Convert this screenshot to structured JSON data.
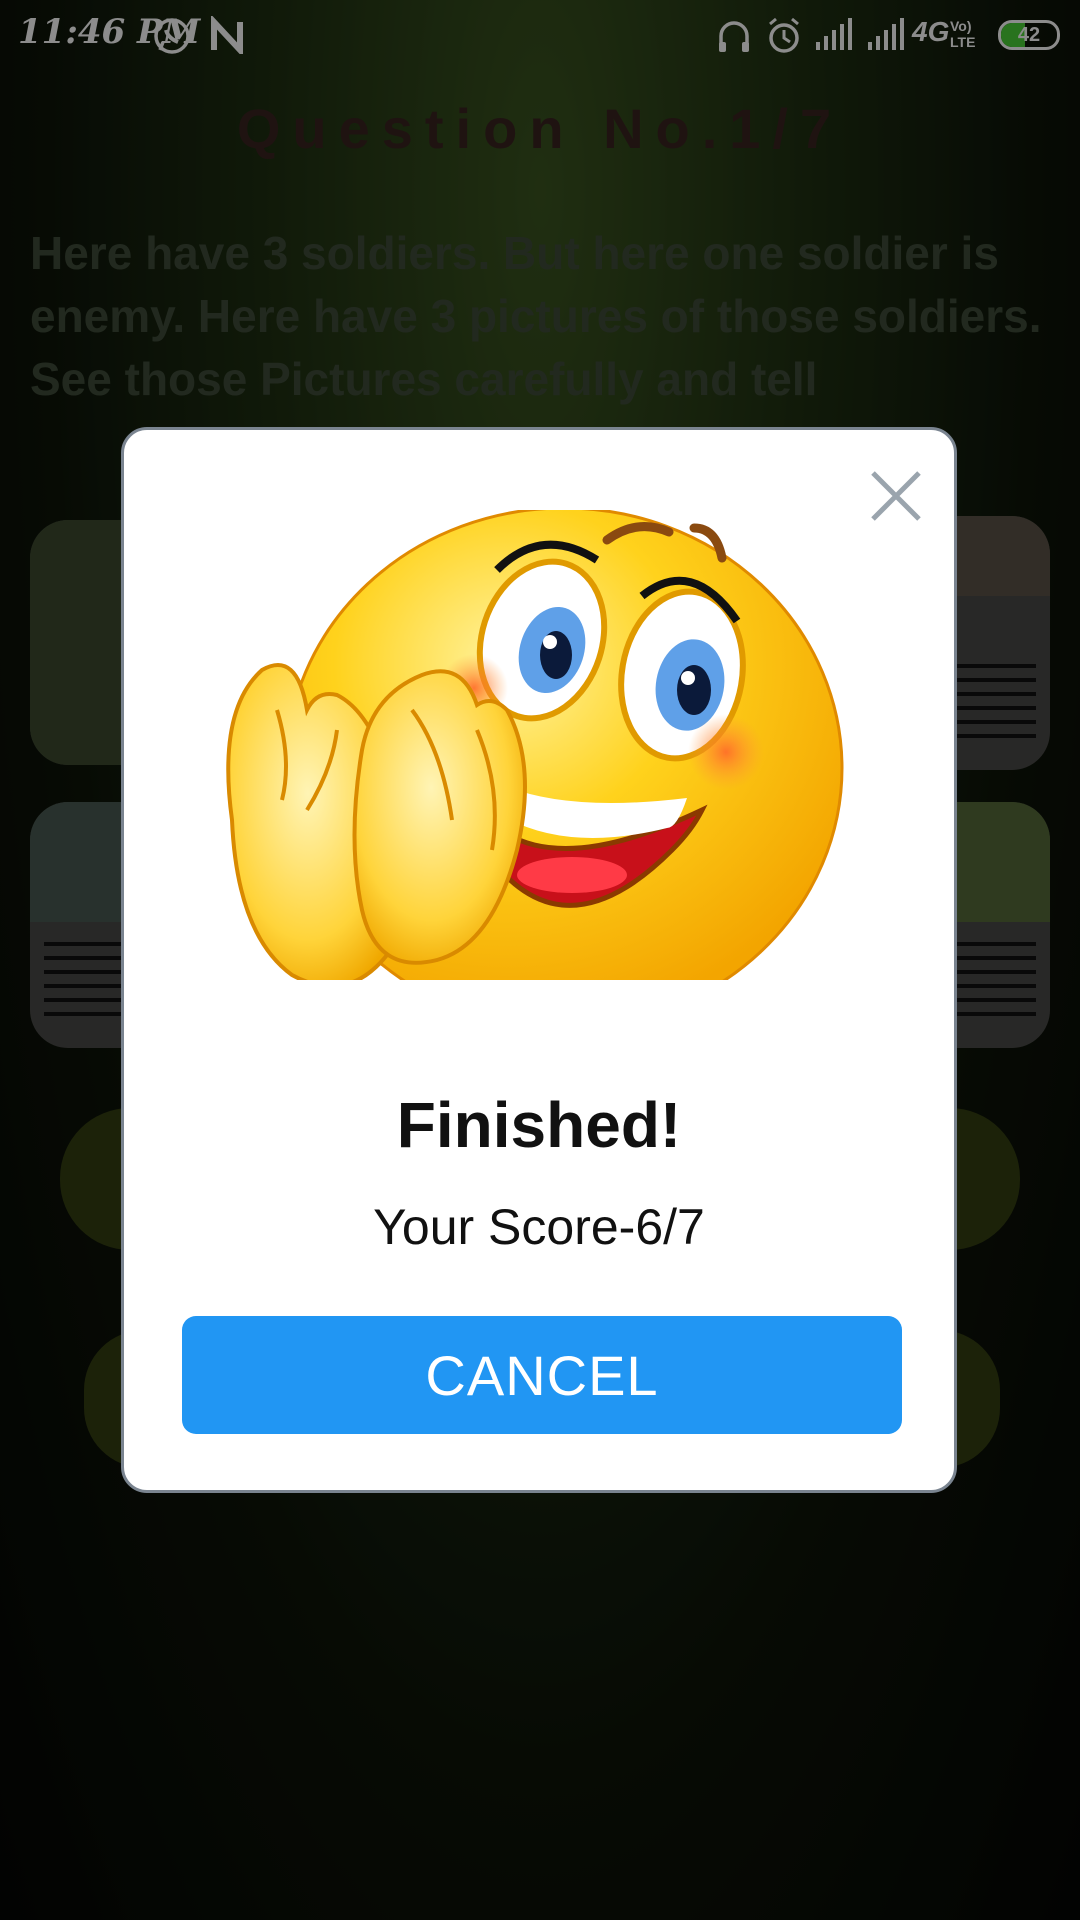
{
  "status_bar": {
    "time": "11:46 PM",
    "left_icons": [
      "whatsapp-icon",
      "n-notification-icon"
    ],
    "right_icons": [
      "headset-icon",
      "alarm-icon",
      "signal-1-icon",
      "signal-2-icon"
    ],
    "network": "4G",
    "volte": "Vo) LTE",
    "battery": "42"
  },
  "quiz": {
    "question_number": "Question No.1/7",
    "question_text": "Here have 3 soldiers. But here one soldier is enemy. Here have 3 pictures of those soldiers. See those Pictures carefully and tell"
  },
  "dialog": {
    "image_icon": "clapping-smiley-icon",
    "title": "Finished!",
    "score": "Your Score-6/7",
    "cancel_label": "CANCEL",
    "cancel_color": "#2196f3"
  }
}
